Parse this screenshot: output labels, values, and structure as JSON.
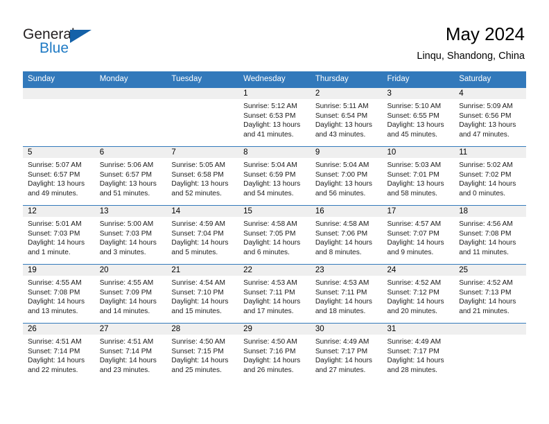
{
  "brand": {
    "name_part1": "General",
    "name_part2": "Blue",
    "triangle_color": "#1461a8",
    "blue_color": "#1f7ac4"
  },
  "header": {
    "title": "May 2024",
    "subtitle": "Linqu, Shandong, China"
  },
  "theme": {
    "header_band": "#3279bb",
    "daynum_band": "#efefef",
    "text": "#000000"
  },
  "weekday_headers": [
    "Sunday",
    "Monday",
    "Tuesday",
    "Wednesday",
    "Thursday",
    "Friday",
    "Saturday"
  ],
  "weeks": [
    [
      {
        "day": "",
        "empty": true
      },
      {
        "day": "",
        "empty": true
      },
      {
        "day": "",
        "empty": true
      },
      {
        "day": "1",
        "sunrise": "Sunrise: 5:12 AM",
        "sunset": "Sunset: 6:53 PM",
        "daylight": "Daylight: 13 hours and 41 minutes."
      },
      {
        "day": "2",
        "sunrise": "Sunrise: 5:11 AM",
        "sunset": "Sunset: 6:54 PM",
        "daylight": "Daylight: 13 hours and 43 minutes."
      },
      {
        "day": "3",
        "sunrise": "Sunrise: 5:10 AM",
        "sunset": "Sunset: 6:55 PM",
        "daylight": "Daylight: 13 hours and 45 minutes."
      },
      {
        "day": "4",
        "sunrise": "Sunrise: 5:09 AM",
        "sunset": "Sunset: 6:56 PM",
        "daylight": "Daylight: 13 hours and 47 minutes."
      }
    ],
    [
      {
        "day": "5",
        "sunrise": "Sunrise: 5:07 AM",
        "sunset": "Sunset: 6:57 PM",
        "daylight": "Daylight: 13 hours and 49 minutes."
      },
      {
        "day": "6",
        "sunrise": "Sunrise: 5:06 AM",
        "sunset": "Sunset: 6:57 PM",
        "daylight": "Daylight: 13 hours and 51 minutes."
      },
      {
        "day": "7",
        "sunrise": "Sunrise: 5:05 AM",
        "sunset": "Sunset: 6:58 PM",
        "daylight": "Daylight: 13 hours and 52 minutes."
      },
      {
        "day": "8",
        "sunrise": "Sunrise: 5:04 AM",
        "sunset": "Sunset: 6:59 PM",
        "daylight": "Daylight: 13 hours and 54 minutes."
      },
      {
        "day": "9",
        "sunrise": "Sunrise: 5:04 AM",
        "sunset": "Sunset: 7:00 PM",
        "daylight": "Daylight: 13 hours and 56 minutes."
      },
      {
        "day": "10",
        "sunrise": "Sunrise: 5:03 AM",
        "sunset": "Sunset: 7:01 PM",
        "daylight": "Daylight: 13 hours and 58 minutes."
      },
      {
        "day": "11",
        "sunrise": "Sunrise: 5:02 AM",
        "sunset": "Sunset: 7:02 PM",
        "daylight": "Daylight: 14 hours and 0 minutes."
      }
    ],
    [
      {
        "day": "12",
        "sunrise": "Sunrise: 5:01 AM",
        "sunset": "Sunset: 7:03 PM",
        "daylight": "Daylight: 14 hours and 1 minute."
      },
      {
        "day": "13",
        "sunrise": "Sunrise: 5:00 AM",
        "sunset": "Sunset: 7:03 PM",
        "daylight": "Daylight: 14 hours and 3 minutes."
      },
      {
        "day": "14",
        "sunrise": "Sunrise: 4:59 AM",
        "sunset": "Sunset: 7:04 PM",
        "daylight": "Daylight: 14 hours and 5 minutes."
      },
      {
        "day": "15",
        "sunrise": "Sunrise: 4:58 AM",
        "sunset": "Sunset: 7:05 PM",
        "daylight": "Daylight: 14 hours and 6 minutes."
      },
      {
        "day": "16",
        "sunrise": "Sunrise: 4:58 AM",
        "sunset": "Sunset: 7:06 PM",
        "daylight": "Daylight: 14 hours and 8 minutes."
      },
      {
        "day": "17",
        "sunrise": "Sunrise: 4:57 AM",
        "sunset": "Sunset: 7:07 PM",
        "daylight": "Daylight: 14 hours and 9 minutes."
      },
      {
        "day": "18",
        "sunrise": "Sunrise: 4:56 AM",
        "sunset": "Sunset: 7:08 PM",
        "daylight": "Daylight: 14 hours and 11 minutes."
      }
    ],
    [
      {
        "day": "19",
        "sunrise": "Sunrise: 4:55 AM",
        "sunset": "Sunset: 7:08 PM",
        "daylight": "Daylight: 14 hours and 13 minutes."
      },
      {
        "day": "20",
        "sunrise": "Sunrise: 4:55 AM",
        "sunset": "Sunset: 7:09 PM",
        "daylight": "Daylight: 14 hours and 14 minutes."
      },
      {
        "day": "21",
        "sunrise": "Sunrise: 4:54 AM",
        "sunset": "Sunset: 7:10 PM",
        "daylight": "Daylight: 14 hours and 15 minutes."
      },
      {
        "day": "22",
        "sunrise": "Sunrise: 4:53 AM",
        "sunset": "Sunset: 7:11 PM",
        "daylight": "Daylight: 14 hours and 17 minutes."
      },
      {
        "day": "23",
        "sunrise": "Sunrise: 4:53 AM",
        "sunset": "Sunset: 7:11 PM",
        "daylight": "Daylight: 14 hours and 18 minutes."
      },
      {
        "day": "24",
        "sunrise": "Sunrise: 4:52 AM",
        "sunset": "Sunset: 7:12 PM",
        "daylight": "Daylight: 14 hours and 20 minutes."
      },
      {
        "day": "25",
        "sunrise": "Sunrise: 4:52 AM",
        "sunset": "Sunset: 7:13 PM",
        "daylight": "Daylight: 14 hours and 21 minutes."
      }
    ],
    [
      {
        "day": "26",
        "sunrise": "Sunrise: 4:51 AM",
        "sunset": "Sunset: 7:14 PM",
        "daylight": "Daylight: 14 hours and 22 minutes."
      },
      {
        "day": "27",
        "sunrise": "Sunrise: 4:51 AM",
        "sunset": "Sunset: 7:14 PM",
        "daylight": "Daylight: 14 hours and 23 minutes."
      },
      {
        "day": "28",
        "sunrise": "Sunrise: 4:50 AM",
        "sunset": "Sunset: 7:15 PM",
        "daylight": "Daylight: 14 hours and 25 minutes."
      },
      {
        "day": "29",
        "sunrise": "Sunrise: 4:50 AM",
        "sunset": "Sunset: 7:16 PM",
        "daylight": "Daylight: 14 hours and 26 minutes."
      },
      {
        "day": "30",
        "sunrise": "Sunrise: 4:49 AM",
        "sunset": "Sunset: 7:17 PM",
        "daylight": "Daylight: 14 hours and 27 minutes."
      },
      {
        "day": "31",
        "sunrise": "Sunrise: 4:49 AM",
        "sunset": "Sunset: 7:17 PM",
        "daylight": "Daylight: 14 hours and 28 minutes."
      },
      {
        "day": "",
        "empty": true
      }
    ]
  ]
}
